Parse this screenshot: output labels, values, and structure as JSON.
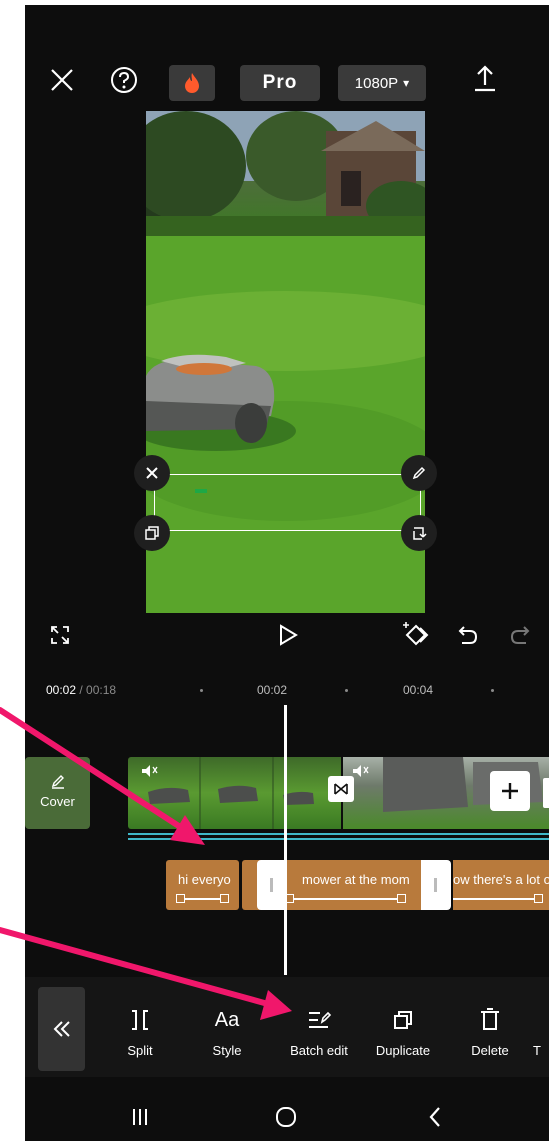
{
  "header": {
    "pro_label": "Pro",
    "resolution_label": "1080P",
    "resolution_caret": "▾"
  },
  "timeline": {
    "current_time": "00:02",
    "separator": " / ",
    "total_time": "00:18",
    "marks": [
      "00:02",
      "00:04"
    ],
    "cover_label": "Cover"
  },
  "captions": [
    {
      "text": "hi everyo"
    },
    {
      "text": "mower at the mom"
    },
    {
      "text": "ow there's a lot o"
    }
  ],
  "toolbar": {
    "items": [
      {
        "label": "Split",
        "icon": "split-icon"
      },
      {
        "label": "Style",
        "icon": "style-icon",
        "glyph": "Aa"
      },
      {
        "label": "Batch edit",
        "icon": "batch-edit-icon"
      },
      {
        "label": "Duplicate",
        "icon": "duplicate-icon"
      },
      {
        "label": "Delete",
        "icon": "delete-icon"
      },
      {
        "label": "T",
        "icon": "text-icon"
      }
    ]
  },
  "colors": {
    "background": "#0d0d0d",
    "caption_bg": "#b87a3c",
    "selection_accent": "#3fb8c9",
    "annotation_arrow": "#f0176b"
  }
}
